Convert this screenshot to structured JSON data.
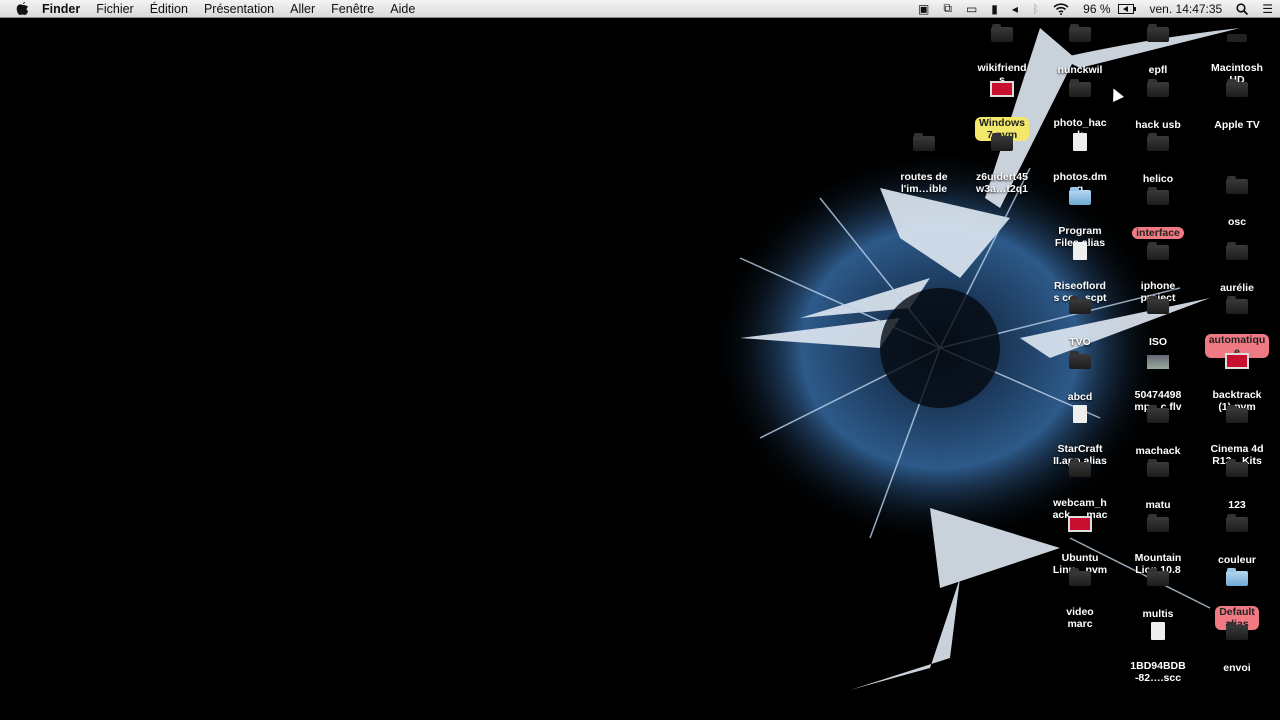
{
  "menubar": {
    "app": "Finder",
    "menus": [
      "Fichier",
      "Édition",
      "Présentation",
      "Aller",
      "Fenêtre",
      "Aide"
    ],
    "battery": "96 %",
    "clock": "ven. 14:47:35",
    "status_icons": [
      "screen-record-icon",
      "screen-share-icon",
      "airplay-icon",
      "battery-extra-icon",
      "volume-icon",
      "bluetooth-icon",
      "wifi-icon",
      "battery-icon",
      "spotlight-icon",
      "notification-center-icon"
    ]
  },
  "desktop": {
    "items": [
      {
        "label": "wikifriend\ns",
        "type": "folder"
      },
      {
        "label": "nunckwil",
        "type": "folder"
      },
      {
        "label": "epfl",
        "type": "folder"
      },
      {
        "label": "Macintosh\nHD",
        "type": "disk"
      },
      {
        "label": "Windows\n7.pvm",
        "type": "pvm",
        "tag": "yellow"
      },
      {
        "label": "photo_hac\nk",
        "type": "folder"
      },
      {
        "label": "hack usb",
        "type": "folder"
      },
      {
        "label": "Apple TV",
        "type": "folder"
      },
      {
        "label": "routes de\nl'im…ible",
        "type": "folder"
      },
      {
        "label": "z6uidert45\nw3a…t2q1",
        "type": "folder"
      },
      {
        "label": "photos.dm\ng",
        "type": "doc"
      },
      {
        "label": "helico",
        "type": "folder"
      },
      {
        "label": "osc",
        "type": "folder"
      },
      {
        "label": "Program\nFiles alias",
        "type": "bluefolder"
      },
      {
        "label": "interface",
        "type": "folder",
        "tag": "red"
      },
      {
        "label": "Riseoflord\ns co…scpt",
        "type": "doc"
      },
      {
        "label": "iphone\nproject",
        "type": "folder"
      },
      {
        "label": "aurélie",
        "type": "folder"
      },
      {
        "label": "TVO",
        "type": "folder"
      },
      {
        "label": "ISO",
        "type": "folder"
      },
      {
        "label": "automatiqu\ne",
        "type": "folder",
        "tag": "red"
      },
      {
        "label": "abcd",
        "type": "folder"
      },
      {
        "label": "50474498\nmp…c.flv",
        "type": "image"
      },
      {
        "label": "backtrack\n(1).pvm",
        "type": "pvm"
      },
      {
        "label": "StarCraft\nII.app alias",
        "type": "doc"
      },
      {
        "label": "machack",
        "type": "folder"
      },
      {
        "label": "Cinema 4d\nR13…Kits",
        "type": "folder"
      },
      {
        "label": "webcam_h\nack_…mac",
        "type": "folder"
      },
      {
        "label": "matu",
        "type": "folder"
      },
      {
        "label": "123",
        "type": "folder"
      },
      {
        "label": "Ubuntu\nLinu…pvm",
        "type": "pvm"
      },
      {
        "label": "Mountain\nLion 10.8",
        "type": "folder"
      },
      {
        "label": "couleur",
        "type": "folder"
      },
      {
        "label": "video\nmarc",
        "type": "folder"
      },
      {
        "label": "multis",
        "type": "folder"
      },
      {
        "label": "Default\nalias",
        "type": "bluefolder",
        "tag": "red"
      },
      {
        "label": "1BD94BDB\n-82….scc",
        "type": "doc"
      },
      {
        "label": "envoi",
        "type": "folder"
      }
    ]
  }
}
